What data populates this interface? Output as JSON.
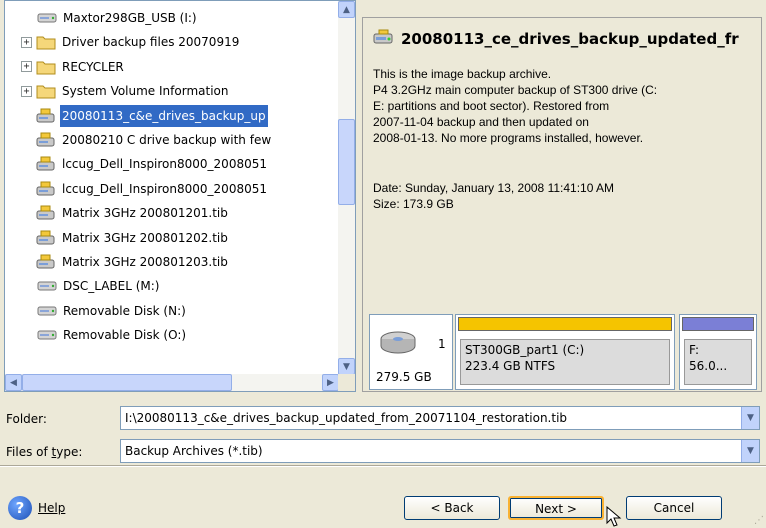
{
  "tree": {
    "items": [
      {
        "label": "Maxtor298GB_USB (I:)",
        "icon": "drive-icon",
        "indent": 0,
        "expander": "",
        "selected": false
      },
      {
        "label": "Driver backup files 20070919",
        "icon": "folder-icon",
        "indent": 1,
        "expander": "+",
        "selected": false
      },
      {
        "label": "RECYCLER",
        "icon": "folder-icon",
        "indent": 1,
        "expander": "+",
        "selected": false
      },
      {
        "label": "System Volume Information",
        "icon": "folder-icon",
        "indent": 1,
        "expander": "+",
        "selected": false
      },
      {
        "label": "20080113_c&e_drives_backup_up",
        "icon": "archive-icon",
        "indent": 1,
        "expander": "",
        "selected": true
      },
      {
        "label": "20080210 C drive backup with few",
        "icon": "archive-icon",
        "indent": 1,
        "expander": "",
        "selected": false
      },
      {
        "label": "lccug_Dell_Inspiron8000_2008051",
        "icon": "archive-icon",
        "indent": 1,
        "expander": "",
        "selected": false
      },
      {
        "label": "lccug_Dell_Inspiron8000_2008051",
        "icon": "archive-icon",
        "indent": 1,
        "expander": "",
        "selected": false
      },
      {
        "label": "Matrix 3GHz 200801201.tib",
        "icon": "archive-icon",
        "indent": 1,
        "expander": "",
        "selected": false
      },
      {
        "label": "Matrix 3GHz 200801202.tib",
        "icon": "archive-icon",
        "indent": 1,
        "expander": "",
        "selected": false
      },
      {
        "label": "Matrix 3GHz 200801203.tib",
        "icon": "archive-icon",
        "indent": 1,
        "expander": "",
        "selected": false
      },
      {
        "label": "DSC_LABEL (M:)",
        "icon": "drive-icon",
        "indent": 0,
        "expander": "",
        "selected": false
      },
      {
        "label": "Removable Disk (N:)",
        "icon": "drive-icon",
        "indent": 0,
        "expander": "",
        "selected": false
      },
      {
        "label": "Removable Disk (O:)",
        "icon": "drive-icon",
        "indent": 0,
        "expander": "",
        "selected": false
      }
    ]
  },
  "info": {
    "title": "20080113_ce_drives_backup_updated_fr",
    "description_lines": [
      "This is the image backup archive.",
      "P4 3.2GHz main computer backup of ST300 drive (C:",
      "E: partitions and boot sector).  Restored from",
      "2007-11-04 backup and then updated on",
      "2008-01-13.  No more programs installed, however."
    ],
    "date": "Date: Sunday, January 13, 2008 11:41:10 AM",
    "size": "Size: 173.9 GB"
  },
  "disk_map": {
    "disk_number": "1",
    "disk_size": "279.5 GB",
    "partitions": [
      {
        "name": "ST300GB_part1 (C:)",
        "detail": "223.4 GB  NTFS",
        "color": "#f5c400"
      },
      {
        "name": "F:",
        "detail": "56.0...",
        "color": "#7b7fd6"
      }
    ]
  },
  "folder": {
    "label": "Folder:",
    "value": "I:\\20080113_c&e_drives_backup_updated_from_20071104_restoration.tib"
  },
  "file_type": {
    "label": "Files of type:",
    "value": "Backup Archives (*.tib)"
  },
  "buttons": {
    "help": "Help",
    "back": "< Back",
    "next": "Next >",
    "cancel": "Cancel"
  },
  "colors": {
    "selection": "#316ac5",
    "window_bg": "#ece9d8"
  }
}
